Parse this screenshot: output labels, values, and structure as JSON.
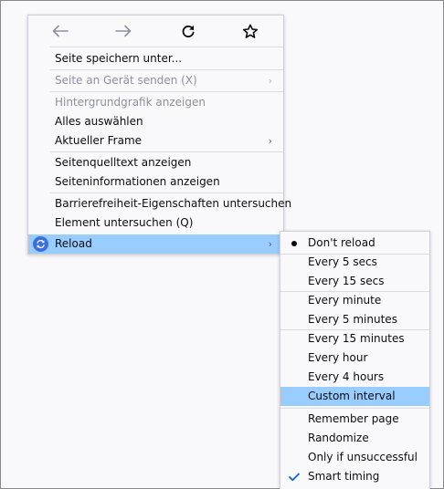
{
  "menu": {
    "nav": {
      "back_icon": "arrow-left-icon",
      "forward_icon": "arrow-right-icon",
      "reload_icon": "reload-icon",
      "bookmark_icon": "star-icon"
    },
    "items": [
      {
        "label": "Seite speichern unter...",
        "disabled": false
      },
      {
        "label": "Seite an Gerät senden (X)",
        "disabled": true,
        "submenu": true
      },
      {
        "label": "Hintergrundgrafik anzeigen",
        "disabled": true
      },
      {
        "label": "Alles auswählen",
        "disabled": false
      },
      {
        "label": "Aktueller Frame",
        "disabled": false,
        "submenu": true
      },
      {
        "label": "Seitenquelltext anzeigen",
        "disabled": false
      },
      {
        "label": "Seiteninformationen anzeigen",
        "disabled": false
      },
      {
        "label": "Barrierefreiheit-Eigenschaften untersuchen",
        "disabled": false
      },
      {
        "label": "Element untersuchen (Q)",
        "disabled": false
      },
      {
        "label": "Reload",
        "disabled": false,
        "submenu": true,
        "highlighted": true,
        "icon": "extension-reload-icon"
      }
    ],
    "chevron": "›"
  },
  "submenu": {
    "items": [
      {
        "label": "Don't reload",
        "checked_radio": true
      },
      {
        "label": "Every 5 secs"
      },
      {
        "label": "Every 15 secs"
      },
      {
        "label": "Every minute"
      },
      {
        "label": "Every 5 minutes"
      },
      {
        "label": "Every 15 minutes"
      },
      {
        "label": "Every hour"
      },
      {
        "label": "Every 4 hours"
      },
      {
        "label": "Custom interval",
        "highlighted": true
      },
      {
        "label": "Remember page"
      },
      {
        "label": "Randomize"
      },
      {
        "label": "Only if unsuccessful"
      },
      {
        "label": "Smart timing",
        "checked": true
      }
    ]
  },
  "colors": {
    "highlight": "#99ccff",
    "reload_icon_bg": "#3b6fe0",
    "checkmark": "#0a64d8"
  }
}
